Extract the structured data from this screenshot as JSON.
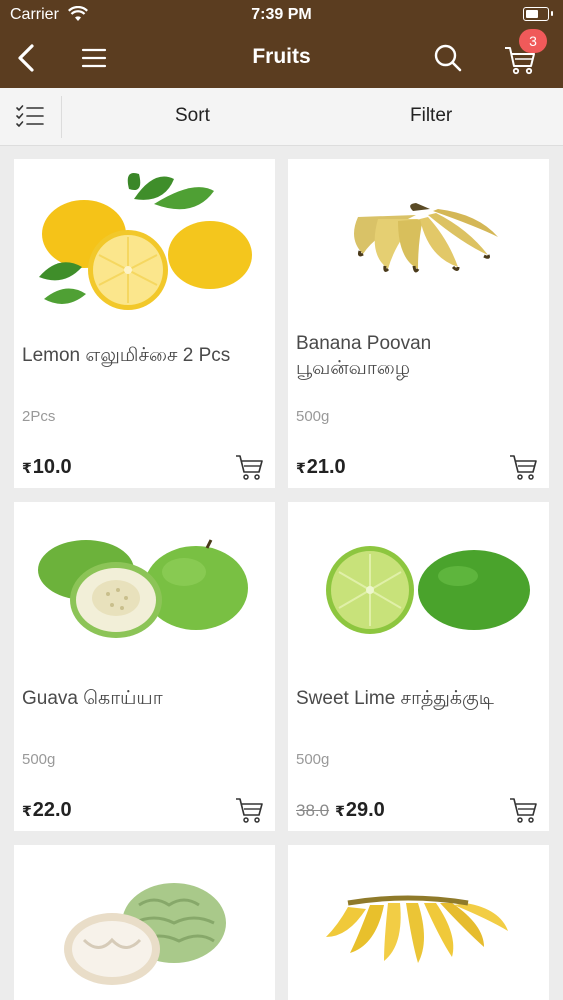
{
  "status_bar": {
    "carrier": "Carrier",
    "time": "7:39 PM",
    "battery_fraction": 0.6
  },
  "nav": {
    "title": "Fruits",
    "cart_count": "3"
  },
  "toolbar": {
    "sort_label": "Sort",
    "filter_label": "Filter"
  },
  "colors": {
    "header": "#5b3d20",
    "badge": "#f05a5a",
    "background": "#ececec"
  },
  "products": [
    {
      "name": "Lemon எலுமிச்சை 2 Pcs",
      "weight": "2Pcs",
      "currency": "₹",
      "price": "10.0",
      "icon": "lemon-image"
    },
    {
      "name": "Banana Poovan பூவன்வாழை",
      "weight": "500g",
      "currency": "₹",
      "price": "21.0",
      "icon": "banana-image"
    },
    {
      "name": "Guava கொய்யா",
      "weight": "500g",
      "currency": "₹",
      "price": "22.0",
      "icon": "guava-image"
    },
    {
      "name": "Sweet Lime சாத்துக்குடி",
      "weight": "500g",
      "currency": "₹",
      "price": "29.0",
      "old_price": "38.0",
      "icon": "sweet-lime-image"
    },
    {
      "name": "",
      "icon": "custard-apple-image"
    },
    {
      "name": "",
      "icon": "banana-bunch-image"
    }
  ]
}
